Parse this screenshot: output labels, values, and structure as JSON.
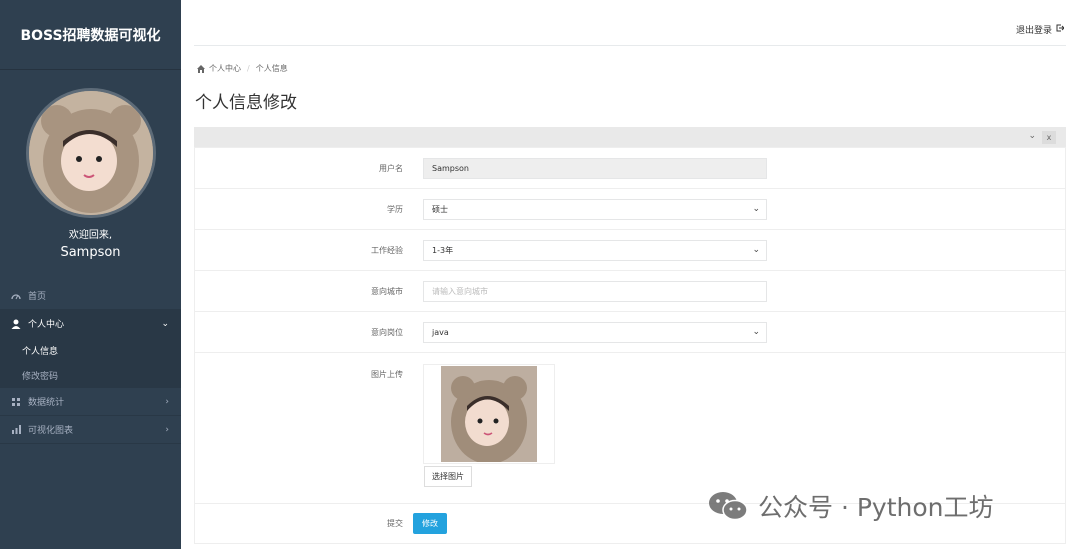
{
  "app": {
    "title": "BOSS招聘数据可视化"
  },
  "user": {
    "welcome": "欢迎回来,",
    "name": "Sampson"
  },
  "sidebar": {
    "items": [
      {
        "label": "首页",
        "icon": "dashboard-icon"
      },
      {
        "label": "个人中心",
        "icon": "user-icon",
        "arrow": "⌄",
        "children": [
          {
            "label": "个人信息"
          },
          {
            "label": "修改密码"
          }
        ]
      },
      {
        "label": "数据统计",
        "icon": "grid-icon",
        "arrow": "›"
      },
      {
        "label": "可视化图表",
        "icon": "bar-chart-icon",
        "arrow": "›"
      }
    ]
  },
  "header": {
    "logout": "退出登录"
  },
  "breadcrumb": {
    "home": "个人中心",
    "current": "个人信息"
  },
  "page": {
    "title": "个人信息修改"
  },
  "form": {
    "username": {
      "label": "用户名",
      "value": "Sampson"
    },
    "education": {
      "label": "学历",
      "value": "硕士"
    },
    "experience": {
      "label": "工作经验",
      "value": "1-3年"
    },
    "city": {
      "label": "意向城市",
      "placeholder": "请输入意向城市"
    },
    "position": {
      "label": "意向岗位",
      "value": "java"
    },
    "image": {
      "label": "图片上传",
      "button": "选择图片"
    },
    "submit": {
      "label": "提交",
      "button": "修改"
    }
  },
  "watermark": {
    "text": "公众号 · Python工坊"
  },
  "colors": {
    "sidebar": "#2f4050",
    "primary": "#23a2de"
  }
}
